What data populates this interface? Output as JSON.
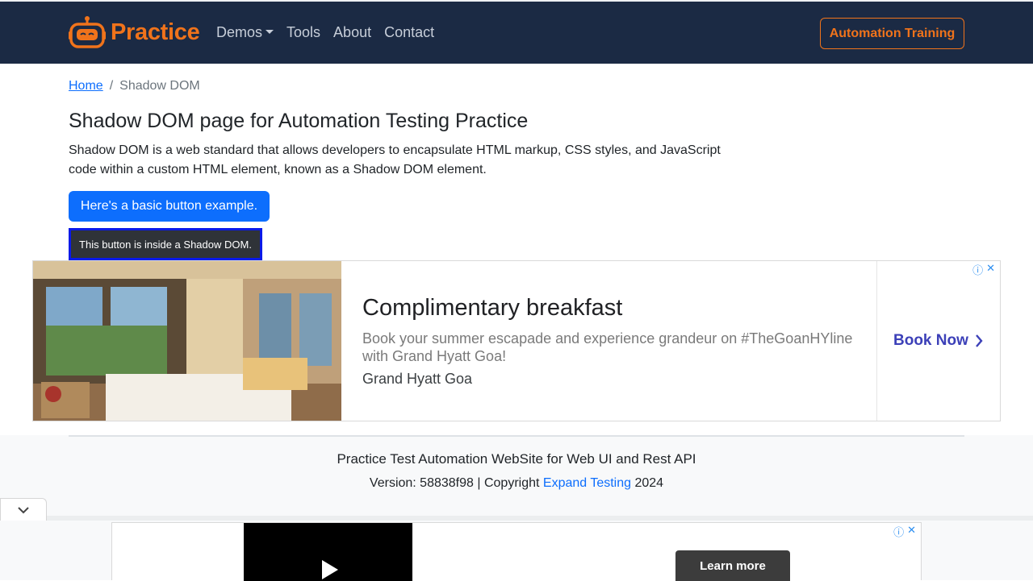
{
  "navbar": {
    "brand": "Practice",
    "links": [
      "Demos",
      "Tools",
      "About",
      "Contact"
    ],
    "cta": "Automation Training"
  },
  "breadcrumb": {
    "home": "Home",
    "separator": "/",
    "current": "Shadow DOM"
  },
  "main": {
    "title": "Shadow DOM page for Automation Testing Practice",
    "description": "Shadow DOM is a web standard that allows developers to encapsulate HTML markup, CSS styles, and JavaScript code within a custom HTML element, known as a Shadow DOM element.",
    "basic_button": "Here's a basic button example.",
    "shadow_button": "This button is inside a Shadow DOM."
  },
  "ad": {
    "headline": "Complimentary breakfast",
    "body": "Book your summer escapade and experience grandeur on #TheGoanHYline with Grand Hyatt Goa!",
    "advertiser": "Grand Hyatt Goa",
    "cta": "Book Now"
  },
  "footer": {
    "title": "Practice Test Automation WebSite for Web UI and Rest API",
    "version_prefix": "Version: 58838f98 | Copyright ",
    "link": "Expand Testing",
    "year": " 2024"
  },
  "bottom_ad": {
    "cta": "Learn more"
  },
  "colors": {
    "navbar": "#1b2a44",
    "accent": "#f0731b",
    "primary": "#0d6efd"
  }
}
